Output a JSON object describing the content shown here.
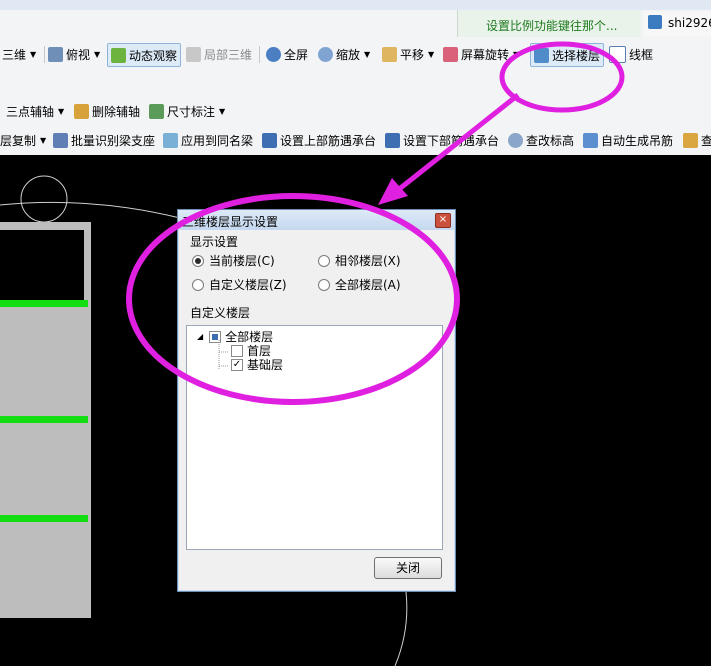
{
  "hint_text": "设置比例功能键往那个...",
  "user_name": "shi2926",
  "toolbar_row1": {
    "three_d": "三维",
    "top_view": "俯视",
    "dynamic_observe": "动态观察",
    "local_3d": "局部三维",
    "full_screen": "全屏",
    "zoom": "缩放",
    "pan": "平移",
    "screen_rotate": "屏幕旋转",
    "select_floor": "选择楼层",
    "wireframe": "线框"
  },
  "toolbar_row2": {
    "three_point_axis": "三点辅轴",
    "delete_axis": "删除辅轴",
    "dimension": "尺寸标注"
  },
  "toolbar_row3": {
    "floor_copy": "层复制",
    "batch_identify": "批量识别梁支座",
    "apply_same_beam": "应用到同名梁",
    "set_top_rebar": "设置上部筋遇承台",
    "set_bottom_rebar": "设置下部筋遇承台",
    "change_elevation": "查改标高",
    "auto_hanger": "自动生成吊筋",
    "more": "查"
  },
  "dialog": {
    "title": "三维楼层显示设置",
    "display_group": "显示设置",
    "radio_current": "当前楼层(C)",
    "radio_adjacent": "相邻楼层(X)",
    "radio_custom": "自定义楼层(Z)",
    "radio_all": "全部楼层(A)",
    "custom_group": "自定义楼层",
    "tree_root": "全部楼层",
    "tree_first": "首层",
    "tree_foundation": "基础层",
    "close_button": "关闭"
  },
  "colors": {
    "annotation": "#e020e0",
    "green_bar": "#11dd11"
  }
}
